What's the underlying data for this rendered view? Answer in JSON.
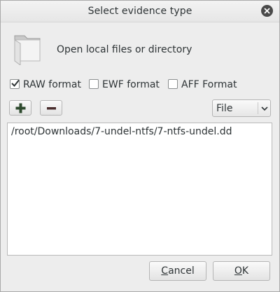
{
  "window": {
    "title": "Select evidence type"
  },
  "source": {
    "icon": "folder-icon",
    "label": "Open local files or directory"
  },
  "formats": [
    {
      "label": "RAW format",
      "checked": true
    },
    {
      "label": "EWF format",
      "checked": false
    },
    {
      "label": "AFF Format",
      "checked": false
    }
  ],
  "toolbar": {
    "add_icon": "plus-icon",
    "remove_icon": "minus-icon",
    "type_selected": "File"
  },
  "files": [
    "/root/Downloads/7-undel-ntfs/7-ntfs-undel.dd"
  ],
  "buttons": {
    "cancel_mnemonic": "C",
    "cancel_rest": "ancel",
    "ok_mnemonic": "O",
    "ok_rest": "K"
  },
  "colors": {
    "add_green": "#2e5c2e",
    "text": "#2e3436"
  }
}
